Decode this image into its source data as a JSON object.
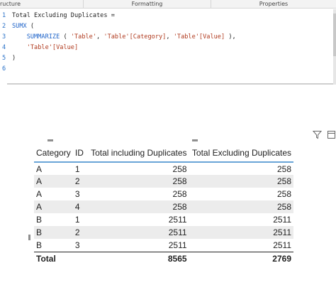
{
  "ribbon": {
    "tabs": [
      "ructure",
      "Formatting",
      "Properties"
    ]
  },
  "formula": {
    "lines": [
      {
        "no": "1",
        "tokens": [
          {
            "t": "Total Excluding Duplicates =",
            "k": "plain"
          }
        ]
      },
      {
        "no": "2",
        "tokens": [
          {
            "t": "SUMX",
            "k": "fn"
          },
          {
            "t": " (",
            "k": "plain"
          }
        ]
      },
      {
        "no": "3",
        "tokens": [
          {
            "t": "    ",
            "k": "plain"
          },
          {
            "t": "SUMMARIZE",
            "k": "fn"
          },
          {
            "t": " ( ",
            "k": "plain"
          },
          {
            "t": "'Table'",
            "k": "str"
          },
          {
            "t": ", ",
            "k": "plain"
          },
          {
            "t": "'Table'[Category]",
            "k": "str"
          },
          {
            "t": ", ",
            "k": "plain"
          },
          {
            "t": "'Table'[Value]",
            "k": "str"
          },
          {
            "t": " ),",
            "k": "plain"
          }
        ]
      },
      {
        "no": "4",
        "tokens": [
          {
            "t": "    ",
            "k": "plain"
          },
          {
            "t": "'Table'[Value]",
            "k": "str"
          }
        ]
      },
      {
        "no": "5",
        "tokens": [
          {
            "t": ")",
            "k": "plain"
          }
        ]
      },
      {
        "no": "6",
        "tokens": [
          {
            "t": "",
            "k": "plain"
          }
        ]
      }
    ]
  },
  "visual_header": {
    "filter_icon": "filter-icon",
    "focus_icon": "focus-mode-icon"
  },
  "table": {
    "headers": [
      "Category",
      "ID",
      "Total including Duplicates",
      "Total Excluding Duplicates"
    ],
    "rows": [
      [
        "A",
        "1",
        "258",
        "258"
      ],
      [
        "A",
        "2",
        "258",
        "258"
      ],
      [
        "A",
        "3",
        "258",
        "258"
      ],
      [
        "A",
        "4",
        "258",
        "258"
      ],
      [
        "B",
        "1",
        "2511",
        "2511"
      ],
      [
        "B",
        "2",
        "2511",
        "2511"
      ],
      [
        "B",
        "3",
        "2511",
        "2511"
      ]
    ],
    "total": [
      "Total",
      "",
      "8565",
      "2769"
    ]
  },
  "colors": {
    "header_rule": "#6aa5d8",
    "band": "#ececec",
    "code_function": "#1e63c9",
    "code_string": "#b03a1e",
    "line_number": "#2b72c8"
  }
}
